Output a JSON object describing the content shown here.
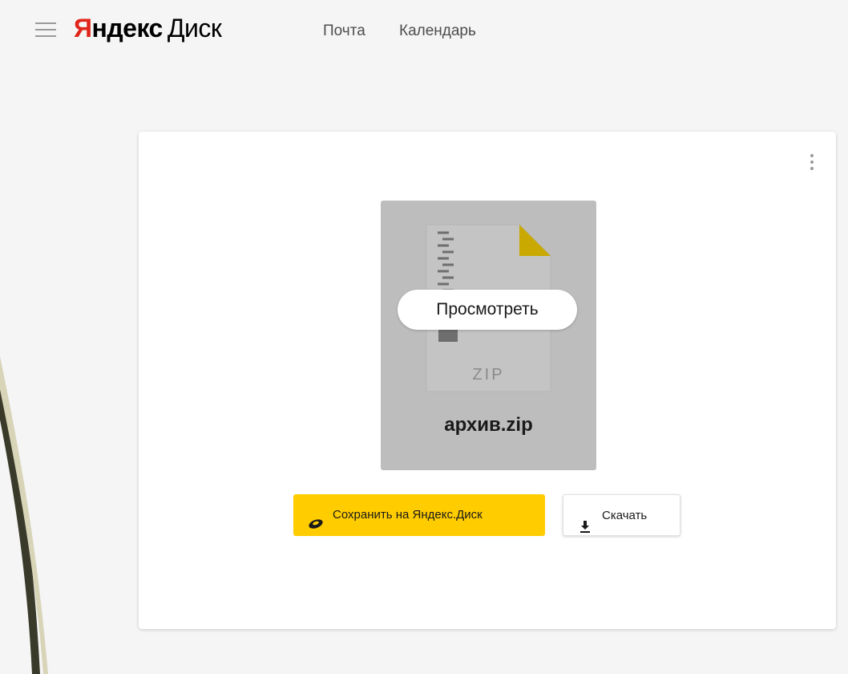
{
  "header": {
    "logo": {
      "brand_first": "Я",
      "brand_rest": "ндекс",
      "product": "Диск"
    },
    "nav": [
      {
        "label": "Почта"
      },
      {
        "label": "Календарь"
      }
    ]
  },
  "file": {
    "type_label": "ZIP",
    "name": "архив.zip",
    "view_label": "Просмотреть"
  },
  "actions": {
    "save_label": "Сохранить на Яндекс.Диск",
    "download_label": "Скачать"
  },
  "colors": {
    "brand_red": "#e1251b",
    "save_button": "#ffcc00",
    "preview_tile": "#bdbdbd",
    "file_corner": "#c9a900"
  },
  "icons": {
    "menu": "hamburger-menu-icon",
    "more": "more-vertical-icon",
    "file": "zip-file-icon",
    "save": "yandex-disk-icon",
    "download": "download-icon"
  }
}
